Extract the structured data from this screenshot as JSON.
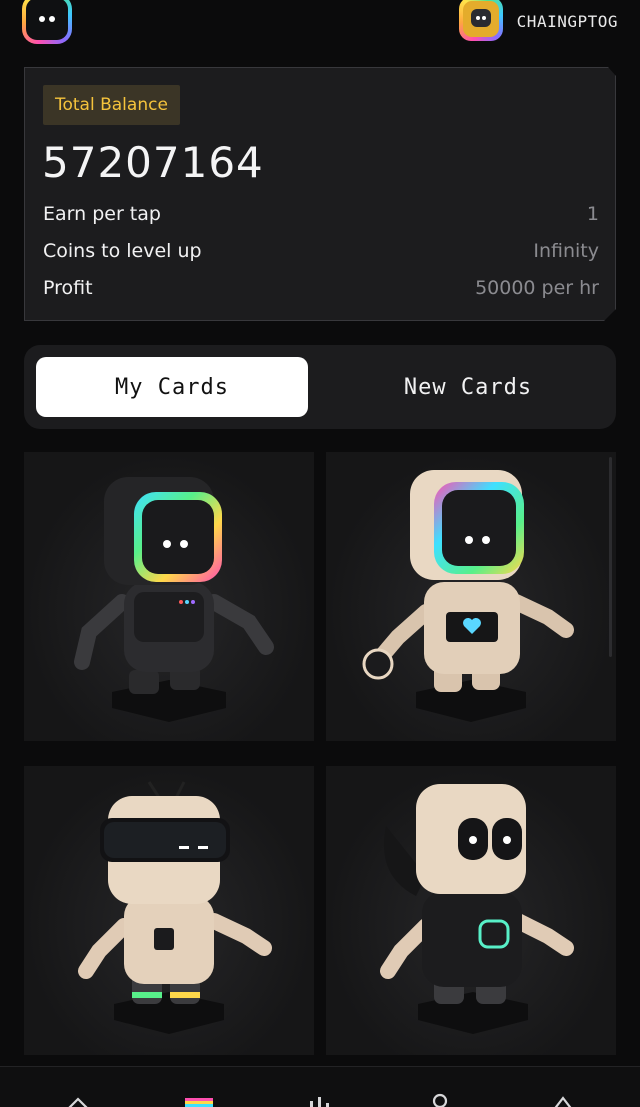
{
  "header": {
    "logo_icon": "chaingpt-logo-icon",
    "avatar_icon": "robot-avatar-icon",
    "username": "CHAINGPTOG"
  },
  "balance": {
    "badge_label": "Total Balance",
    "amount": "57207164",
    "stats": [
      {
        "label": "Earn per tap",
        "value": "1"
      },
      {
        "label": "Coins to level up",
        "value": "Infinity"
      },
      {
        "label": "Profit",
        "value": "50000 per hr"
      }
    ]
  },
  "tabs": [
    {
      "label": "My Cards",
      "active": true
    },
    {
      "label": "New Cards",
      "active": false
    }
  ],
  "cards": [
    {
      "name": "black-robot-card"
    },
    {
      "name": "beige-robot-card"
    },
    {
      "name": "visor-robot-card"
    },
    {
      "name": "hoodie-robot-card"
    }
  ],
  "nav": {
    "items": [
      "home-icon",
      "cards-icon",
      "chart-icon",
      "profile-icon",
      "rank-icon"
    ]
  },
  "colors": {
    "accent_yellow": "#f5c33c",
    "background": "#0b0b0c",
    "panel": "#1c1c1e"
  }
}
